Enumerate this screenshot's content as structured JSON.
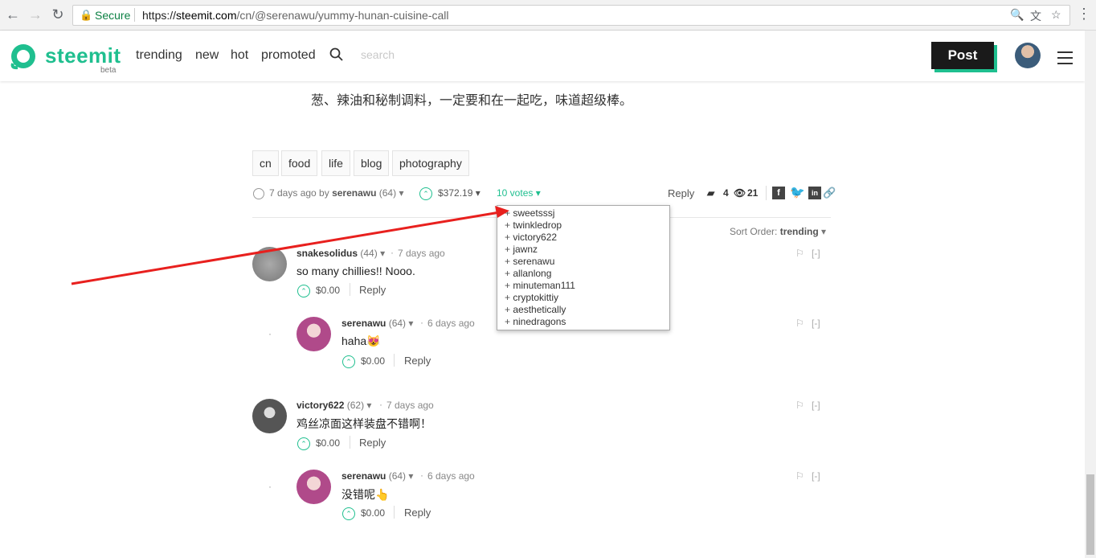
{
  "browser": {
    "secure_label": "Secure",
    "url_scheme": "https://",
    "url_host": "steemit.com",
    "url_path": "/cn/@serenawu/yummy-hunan-cuisine-call"
  },
  "header": {
    "logo_text": "steemit",
    "logo_beta": "beta",
    "nav": [
      "trending",
      "new",
      "hot",
      "promoted"
    ],
    "search_placeholder": "search",
    "post_label": "Post"
  },
  "article": {
    "text": "葱、辣油和秘制调料，一定要和在一起吃，味道超级棒。",
    "tags": [
      "cn",
      "food",
      "life",
      "blog",
      "photography"
    ],
    "meta": {
      "time_prefix": "7 days ago by",
      "author": "serenawu",
      "rep": "(64)",
      "payout": "$372.19",
      "votes": "10 votes",
      "reply": "Reply",
      "comments_count": "4",
      "views_count": "21"
    },
    "voters": [
      "sweetsssj",
      "twinkledrop",
      "victory622",
      "jawnz",
      "serenawu",
      "allanlong",
      "minuteman111",
      "cryptokittiy",
      "aesthetically",
      "ninedragons"
    ],
    "sort_label": "Sort Order:",
    "sort_value": "trending"
  },
  "comments": [
    {
      "author": "snakesolidus",
      "rep": "(44)",
      "time": "7 days ago",
      "body": "so many chillies!! Nooo.",
      "payout": "$0.00",
      "reply": "Reply",
      "collapse": "[-]"
    },
    {
      "author": "serenawu",
      "rep": "(64)",
      "time": "6 days ago",
      "body": "haha😻",
      "payout": "$0.00",
      "reply": "Reply",
      "collapse": "[-]"
    },
    {
      "author": "victory622",
      "rep": "(62)",
      "time": "7 days ago",
      "body": "鸡丝凉面这样装盘不错啊！",
      "payout": "$0.00",
      "reply": "Reply",
      "collapse": "[-]"
    },
    {
      "author": "serenawu",
      "rep": "(64)",
      "time": "6 days ago",
      "body": "没错呢👆",
      "payout": "$0.00",
      "reply": "Reply",
      "collapse": "[-]"
    }
  ],
  "colors": {
    "brand": "#1fbf8f",
    "annotation": "#e8201e"
  }
}
